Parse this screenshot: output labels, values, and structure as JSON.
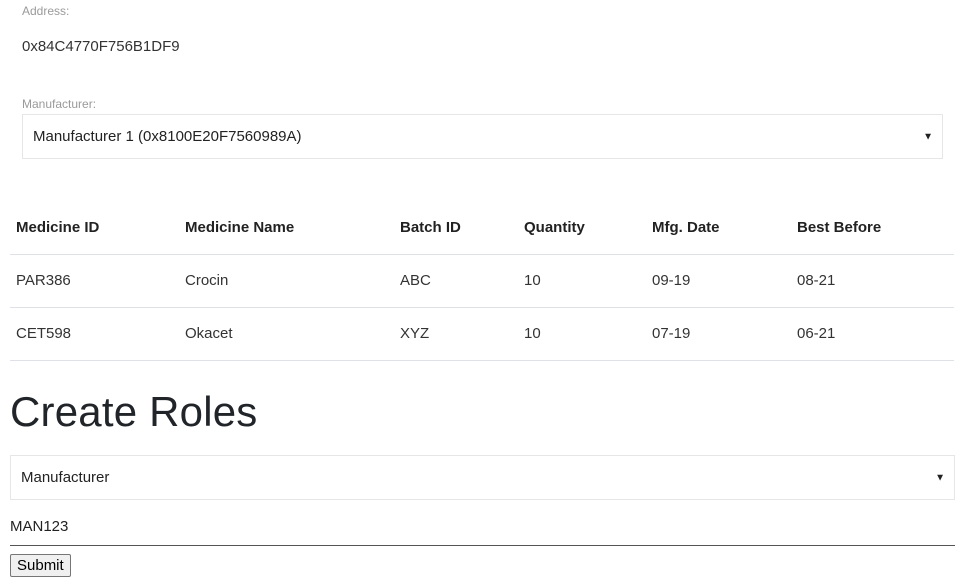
{
  "address": {
    "label": "Address:",
    "value": "0x84C4770F756B1DF9"
  },
  "manufacturer": {
    "label": "Manufacturer:",
    "selected": "Manufacturer 1 (0x8100E20F7560989A)"
  },
  "medicine_table": {
    "headers": [
      "Medicine ID",
      "Medicine Name",
      "Batch ID",
      "Quantity",
      "Mfg. Date",
      "Best Before"
    ],
    "rows": [
      [
        "PAR386",
        "Crocin",
        "ABC",
        "10",
        "09-19",
        "08-21"
      ],
      [
        "CET598",
        "Okacet",
        "XYZ",
        "10",
        "07-19",
        "06-21"
      ]
    ]
  },
  "create_roles": {
    "title": "Create Roles",
    "role_selected": "Manufacturer",
    "id_value": "MAN123",
    "submit_label": "Submit"
  }
}
